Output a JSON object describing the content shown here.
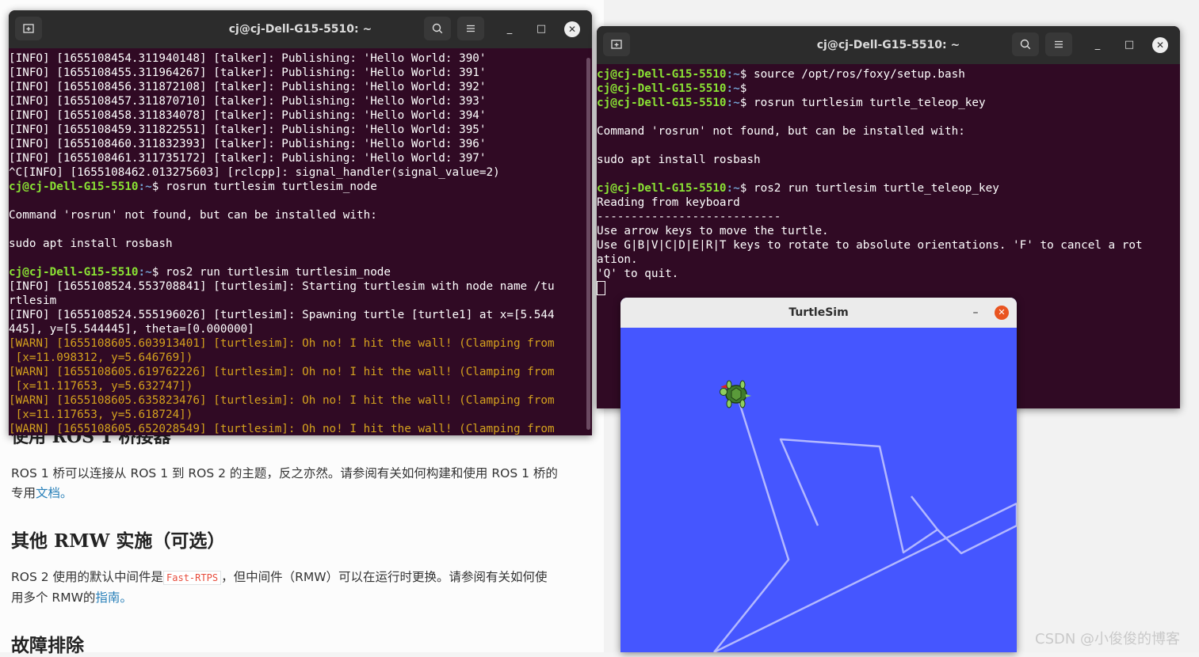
{
  "document": {
    "partial_heading": "使用 ROS 1 桥接器",
    "bridge_text_a": "ROS 1 桥可以连接从 ROS 1 到 ROS 2 的主题，反之亦然。请参阅有关如何构建和使用 ROS 1 桥的",
    "bridge_text_b": "专用",
    "bridge_link": "文档。",
    "rmw_heading": "其他 RMW 实施（可选）",
    "rmw_text_a": "ROS 2 使用的默认中间件是",
    "rmw_code": "Fast-RTPS",
    "rmw_text_b": "，但中间件（RMW）可以在运行时更换。请参阅有关如何使",
    "rmw_text_c": "用多个 RMW的",
    "rmw_link": "指南。",
    "trouble_heading": "故障排除"
  },
  "terminal_left": {
    "title": "cj@cj-Dell-G15-5510: ~",
    "prompt_user": "cj@cj-Dell-G15-5510",
    "prompt_path": ":~",
    "lines": [
      {
        "kind": "out",
        "text": "[INFO] [1655108454.311940148] [talker]: Publishing: 'Hello World: 390'"
      },
      {
        "kind": "out",
        "text": "[INFO] [1655108455.311964267] [talker]: Publishing: 'Hello World: 391'"
      },
      {
        "kind": "out",
        "text": "[INFO] [1655108456.311872108] [talker]: Publishing: 'Hello World: 392'"
      },
      {
        "kind": "out",
        "text": "[INFO] [1655108457.311870710] [talker]: Publishing: 'Hello World: 393'"
      },
      {
        "kind": "out",
        "text": "[INFO] [1655108458.311834078] [talker]: Publishing: 'Hello World: 394'"
      },
      {
        "kind": "out",
        "text": "[INFO] [1655108459.311822551] [talker]: Publishing: 'Hello World: 395'"
      },
      {
        "kind": "out",
        "text": "[INFO] [1655108460.311832393] [talker]: Publishing: 'Hello World: 396'"
      },
      {
        "kind": "out",
        "text": "[INFO] [1655108461.311735172] [talker]: Publishing: 'Hello World: 397'"
      },
      {
        "kind": "out",
        "text": "^C[INFO] [1655108462.013275603] [rclcpp]: signal_handler(signal_value=2)"
      },
      {
        "kind": "prompt",
        "text": "$ rosrun turtlesim turtlesim_node"
      },
      {
        "kind": "out",
        "text": ""
      },
      {
        "kind": "out",
        "text": "Command 'rosrun' not found, but can be installed with:"
      },
      {
        "kind": "out",
        "text": ""
      },
      {
        "kind": "out",
        "text": "sudo apt install rosbash"
      },
      {
        "kind": "out",
        "text": ""
      },
      {
        "kind": "prompt",
        "text": "$ ros2 run turtlesim turtlesim_node"
      },
      {
        "kind": "out",
        "text": "[INFO] [1655108524.553708841] [turtlesim]: Starting turtlesim with node name /tu"
      },
      {
        "kind": "out",
        "text": "rtlesim"
      },
      {
        "kind": "out",
        "text": "[INFO] [1655108524.555196026] [turtlesim]: Spawning turtle [turtle1] at x=[5.544"
      },
      {
        "kind": "out",
        "text": "445], y=[5.544445], theta=[0.000000]"
      },
      {
        "kind": "warn",
        "text": "[WARN] [1655108605.603913401] [turtlesim]: Oh no! I hit the wall! (Clamping from"
      },
      {
        "kind": "warn",
        "text": " [x=11.098312, y=5.646769])"
      },
      {
        "kind": "warn",
        "text": "[WARN] [1655108605.619762226] [turtlesim]: Oh no! I hit the wall! (Clamping from"
      },
      {
        "kind": "warn",
        "text": " [x=11.117653, y=5.632747])"
      },
      {
        "kind": "warn",
        "text": "[WARN] [1655108605.635823476] [turtlesim]: Oh no! I hit the wall! (Clamping from"
      },
      {
        "kind": "warn",
        "text": " [x=11.117653, y=5.618724])"
      },
      {
        "kind": "warn",
        "text": "[WARN] [1655108605.652028549] [turtlesim]: Oh no! I hit the wall! (Clamping from"
      }
    ]
  },
  "terminal_right": {
    "title": "cj@cj-Dell-G15-5510: ~",
    "prompt_user": "cj@cj-Dell-G15-5510",
    "prompt_path": ":~",
    "lines": [
      {
        "kind": "prompt",
        "text": "$ source /opt/ros/foxy/setup.bash"
      },
      {
        "kind": "prompt",
        "text": "$"
      },
      {
        "kind": "prompt",
        "text": "$ rosrun turtlesim turtle_teleop_key"
      },
      {
        "kind": "out",
        "text": ""
      },
      {
        "kind": "out",
        "text": "Command 'rosrun' not found, but can be installed with:"
      },
      {
        "kind": "out",
        "text": ""
      },
      {
        "kind": "out",
        "text": "sudo apt install rosbash"
      },
      {
        "kind": "out",
        "text": ""
      },
      {
        "kind": "prompt",
        "text": "$ ros2 run turtlesim turtle_teleop_key"
      },
      {
        "kind": "out",
        "text": "Reading from keyboard"
      },
      {
        "kind": "out",
        "text": "---------------------------"
      },
      {
        "kind": "out",
        "text": "Use arrow keys to move the turtle."
      },
      {
        "kind": "out",
        "text": "Use G|B|V|C|D|E|R|T keys to rotate to absolute orientations. 'F' to cancel a rot"
      },
      {
        "kind": "out",
        "text": "ation."
      },
      {
        "kind": "out",
        "text": "'Q' to quit."
      },
      {
        "kind": "cursor",
        "text": ""
      }
    ]
  },
  "turtlesim": {
    "title": "TurtleSim",
    "background_color": "#4556ff",
    "trail_color": "#b3b8ff"
  },
  "icons": {
    "new_tab": "new-tab-icon",
    "search": "search-icon",
    "menu": "hamburger-menu-icon",
    "minimize": "minimize-icon",
    "maximize": "maximize-icon",
    "close": "close-icon",
    "turtle": "turtle-icon"
  },
  "watermark": "CSDN @小俊俊的博客"
}
